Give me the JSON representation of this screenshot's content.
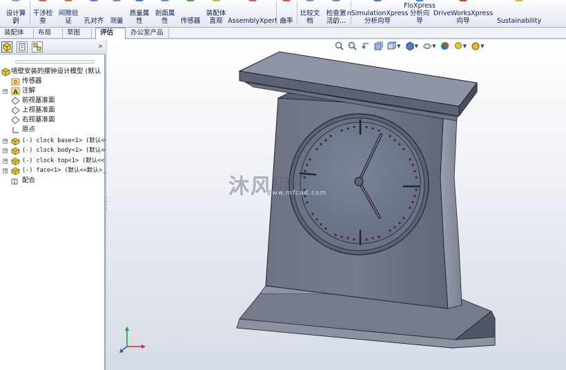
{
  "ribbon": {
    "buttons": [
      {
        "label": "设计算\n例",
        "has_dropdown": true
      },
      {
        "label": "干涉检\n查"
      },
      {
        "label": "间隙验\n证"
      },
      {
        "label": "孔对齐"
      },
      {
        "label": "测量"
      },
      {
        "label": "质量属\n性"
      },
      {
        "label": "剖面属\n性"
      },
      {
        "label": "传感器"
      },
      {
        "label": "装配体\n直观"
      },
      {
        "label": "AssemblyXpert"
      },
      {
        "label": "曲率"
      },
      {
        "label": "比较文\n档"
      },
      {
        "label": "检查激\n活的...",
        "has_dropdown": true
      },
      {
        "label": "nSimulationXpress\n分析向导"
      },
      {
        "label": "FloXpress\n分析向\n导"
      },
      {
        "label": "DriveWorksXpress\n向导"
      },
      {
        "label": "Sustainability"
      }
    ]
  },
  "tabs": [
    {
      "label": "装配体",
      "active": false
    },
    {
      "label": "布局",
      "active": false
    },
    {
      "label": "草图",
      "active": false
    },
    {
      "label": "评估",
      "active": true
    },
    {
      "label": "办公室产品",
      "active": false
    }
  ],
  "panel": {
    "expander": "»",
    "tree": [
      {
        "label": "墙壁安装的摆钟设计模型  (默认",
        "icon": "assembly-icon",
        "expandable": false,
        "level": 0
      },
      {
        "label": "传感器",
        "icon": "sensor-folder-icon",
        "expandable": false,
        "level": 1
      },
      {
        "label": "注解",
        "icon": "annotation-icon",
        "expandable": true,
        "level": 1
      },
      {
        "label": "前视基准面",
        "icon": "plane-icon",
        "expandable": false,
        "level": 1
      },
      {
        "label": "上视基准面",
        "icon": "plane-icon",
        "expandable": false,
        "level": 1
      },
      {
        "label": "右视基准面",
        "icon": "plane-icon",
        "expandable": false,
        "level": 1
      },
      {
        "label": "原点",
        "icon": "origin-icon",
        "expandable": false,
        "level": 1
      },
      {
        "label": "(-) clock base<1> (默认<<",
        "icon": "part-icon",
        "expandable": true,
        "level": 1,
        "mono": true
      },
      {
        "label": "(-) clock body<1> (默认<<",
        "icon": "part-icon",
        "expandable": true,
        "level": 1,
        "mono": true
      },
      {
        "label": "(-) clock top<1> (默认<<",
        "icon": "part-icon",
        "expandable": true,
        "level": 1,
        "mono": true
      },
      {
        "label": "(-) face<1> (默认<<默认>_",
        "icon": "part-icon",
        "expandable": true,
        "level": 1,
        "mono": true
      },
      {
        "label": "配合",
        "icon": "mates-icon",
        "expandable": false,
        "level": 1
      }
    ]
  },
  "viewport": {
    "heads_up_icons": [
      "zoom-to-fit-icon",
      "zoom-area-icon",
      "previous-view-icon",
      "section-view-icon",
      "view-orientation-icon",
      "display-style-icon",
      "hide-show-icon",
      "edit-appearance-icon",
      "scene-icon",
      "view-settings-icon"
    ],
    "watermark": "沐风网",
    "watermark_url": "www.mfcad.com"
  },
  "colors": {
    "model_face": "#6e7688",
    "model_light": "#9aa0b0",
    "model_dark": "#3b4150",
    "ribbon_text": "#0a1b4f"
  }
}
